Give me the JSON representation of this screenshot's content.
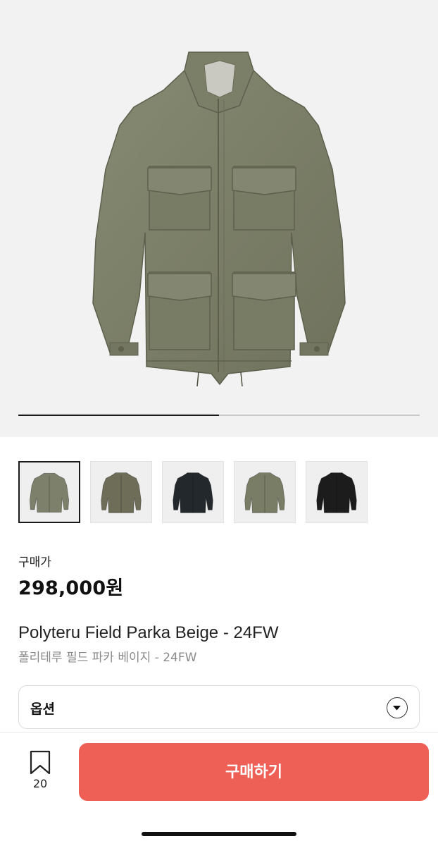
{
  "gallery": {
    "current_image": 1,
    "total_images": 2,
    "progress_fraction": 0.5,
    "thumbnails": [
      {
        "color_name": "olive-green",
        "color": "#7d806a",
        "selected": true
      },
      {
        "color_name": "olive-brown",
        "color": "#6d6d58",
        "selected": false
      },
      {
        "color_name": "dark-navy",
        "color": "#23282c",
        "selected": false
      },
      {
        "color_name": "olive-green",
        "color": "#7a7d66",
        "selected": false
      },
      {
        "color_name": "black",
        "color": "#1c1c1c",
        "selected": false
      }
    ]
  },
  "product": {
    "price_label": "구매가",
    "price": "298,000원",
    "title_en": "Polyteru Field Parka Beige - 24FW",
    "title_ko": "폴리테루 필드 파카 베이지 - 24FW"
  },
  "options": {
    "label": "옵션",
    "icon": "chevron-down-icon"
  },
  "bottom_bar": {
    "bookmark_icon": "bookmark-icon",
    "bookmark_count": "20",
    "buy_label": "구매하기"
  },
  "colors": {
    "accent": "#ee5f55",
    "jacket": "#7e8169",
    "hero_background": "#f2f2f2"
  }
}
